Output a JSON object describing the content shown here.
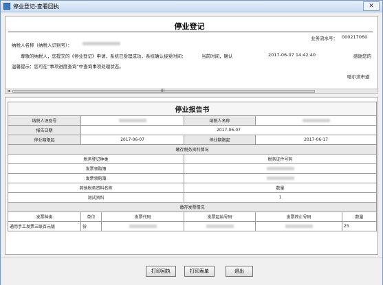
{
  "window": {
    "title": "停业登记-查看回执",
    "close_label": "✕"
  },
  "top": {
    "title": "停业登记",
    "serial_label": "业务流水号：",
    "serial_value": "000217060",
    "taxpayer_name_label": "纳税人名称（纳税人识别号）：",
    "message": "尊敬的纳税人，您提交的《停业登记》申请，系统已受理成功，系统确认接受时间：",
    "time_label": "当前时间，确认",
    "time_value": "2017-06-07 14:42:40",
    "thanks": "感谢您的",
    "tip": "温馨提示：您可在“事项进度查询”中查询事项处理状态。",
    "office": "哈尔滨市道"
  },
  "scroll": {
    "left_arrow": "◄",
    "thumb_grip": "|||"
  },
  "report": {
    "title": "停业报告书",
    "taxpayer_id_label": "纳税人识别号",
    "taxpayer_name_label": "纳税人名称",
    "report_date_label": "报告日期",
    "report_date": "2017-06-07",
    "start_label": "停业期限起",
    "start_date": "2017-06-07",
    "end_label": "停业期限起",
    "end_date": "2017-06-17",
    "deposit_section": "缴存税务资料情况",
    "cert_type_label": "税务登记种类",
    "cert_no_label": "税务证件号码",
    "invoice_book1": "发票领购簿",
    "invoice_book2": "发票领购簿",
    "other_name_label": "其他税务资料名称",
    "qty_label": "数量",
    "test_item": "测试资料",
    "test_qty": "1",
    "invoice_section": "缴存发票情况",
    "col_kind": "发票种类",
    "col_unit": "单位",
    "col_code": "发票代码",
    "col_start": "发票起始号码",
    "col_end": "发票终止号码",
    "col_qty": "数量",
    "row_kind": "通用手工发票三联百元版",
    "row_unit": "份",
    "row_qty": "25"
  },
  "buttons": {
    "print_receipt": "打印回执",
    "print_form": "打印表单",
    "exit": "退出"
  }
}
